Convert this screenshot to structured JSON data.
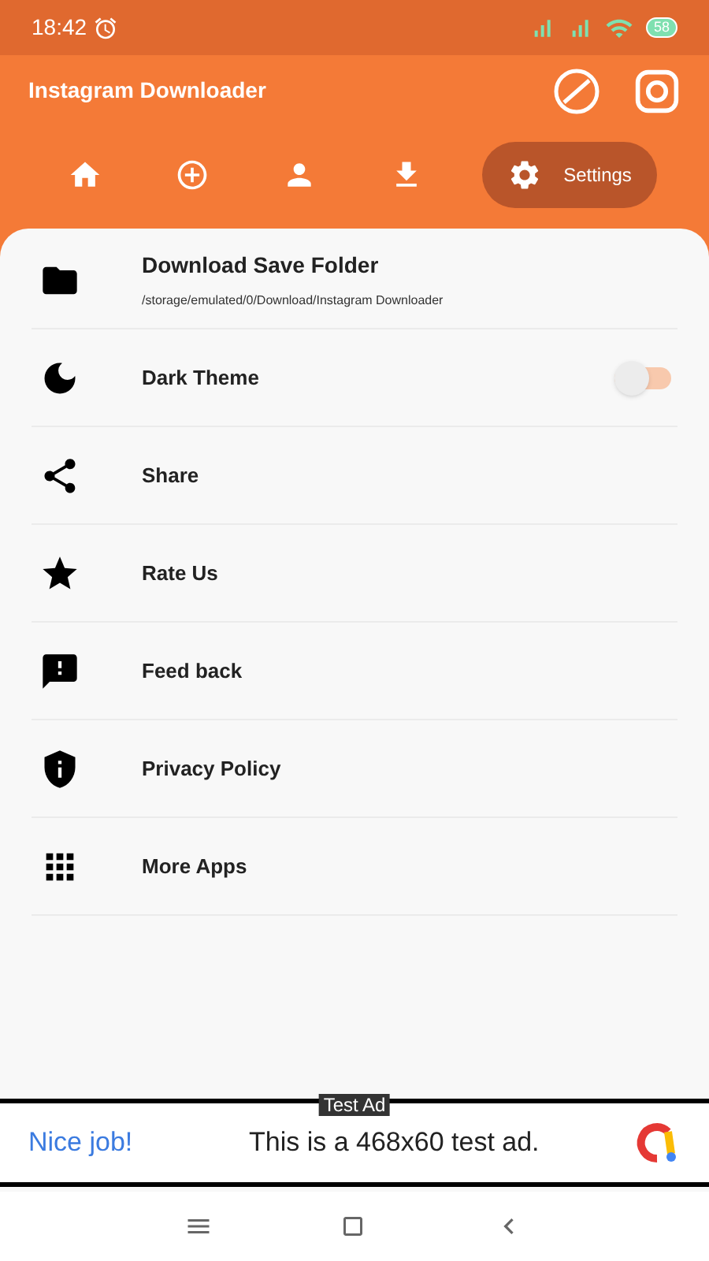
{
  "status_bar": {
    "time": "18:42",
    "battery": "58"
  },
  "app_bar": {
    "title": "Instagram Downloader"
  },
  "tabs": [
    {
      "selected": false
    },
    {
      "selected": false
    },
    {
      "selected": false
    },
    {
      "selected": false
    },
    {
      "label": "Settings",
      "selected": true
    }
  ],
  "settings": [
    {
      "kind": "folder",
      "label": "Download Save Folder",
      "subtitle": "/storage/emulated/0/Download/Instagram Downloader"
    },
    {
      "kind": "toggle",
      "label": "Dark Theme",
      "on": false
    },
    {
      "kind": "plain",
      "label": "Share"
    },
    {
      "kind": "plain",
      "label": "Rate Us"
    },
    {
      "kind": "plain",
      "label": "Feed back"
    },
    {
      "kind": "plain",
      "label": "Privacy Policy"
    },
    {
      "kind": "plain",
      "label": "More Apps"
    }
  ],
  "ad": {
    "badge": "Test Ad",
    "headline": "Nice job!",
    "text": "This is a 468x60 test ad."
  }
}
